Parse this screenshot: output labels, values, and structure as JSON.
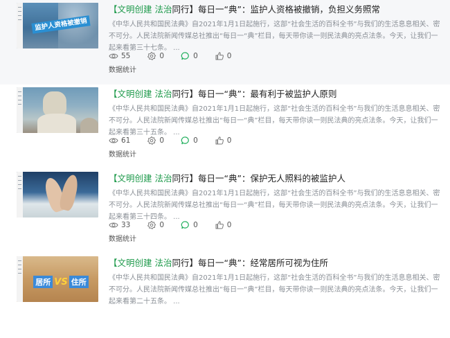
{
  "articles": [
    {
      "tag": "【文明创建 法治",
      "tag_suffix": "同行】",
      "title": "每日一“典”：监护人资格被撤销，负担义务照常",
      "summary": "《中华人民共和国民法典》自2021年1月1日起施行，这部“社会生活的百科全书”与我们的生活息息相关、密不可分。人民法院新闻传媒总社推出“每日一“典”栏目，每天带你读一则民法典的亮点法条。今天，让我们一起来看第三十七条。 ...",
      "thumb_caption": "监护人资格被撤销",
      "views": "55",
      "shares": "0",
      "comments": "0",
      "likes": "0",
      "data_link": "数据统计"
    },
    {
      "tag": "【文明创建 法治",
      "tag_suffix": "同行】",
      "title": "每日一“典”：最有利于被监护人原则",
      "summary": "《中华人民共和国民法典》自2021年1月1日起施行，这部“社会生活的百科全书”与我们的生活息息相关、密不可分。人民法院新闻传媒总社推出“每日一“典”栏目，每天带你读一则民法典的亮点法条。今天，让我们一起来看第三十五条。 ...",
      "thumb_caption": "",
      "views": "61",
      "shares": "0",
      "comments": "0",
      "likes": "0",
      "data_link": "数据统计"
    },
    {
      "tag": "【文明创建 法治",
      "tag_suffix": "同行】",
      "title": "每日一“典”：保护无人照料的被监护人",
      "summary": "《中华人民共和国民法典》自2021年1月1日起施行，这部“社会生活的百科全书”与我们的生活息息相关、密不可分。人民法院新闻传媒总社推出“每日一“典”栏目，每天带你读一则民法典的亮点法条。今天，让我们一起来看第三十四条。 ...",
      "thumb_caption": "",
      "views": "33",
      "shares": "0",
      "comments": "0",
      "likes": "0",
      "data_link": "数据统计"
    },
    {
      "tag": "【文明创建 法治",
      "tag_suffix": "同行】",
      "title": "每日一“典”：经常居所可视为住所",
      "summary": "《中华人民共和国民法典》自2021年1月1日起施行，这部“社会生活的百科全书”与我们的生活息息相关、密不可分。人民法院新闻传媒总社推出“每日一“典”栏目，每天带你读一则民法典的亮点法条。今天，让我们一起来看第二十五条。 ...",
      "thumb_caption_a": "居所",
      "thumb_caption_vs": "VS",
      "thumb_caption_b": "住所",
      "views": "",
      "shares": "",
      "comments": "",
      "likes": "",
      "data_link": ""
    }
  ],
  "colors": {
    "tag_green": "#1e9a4b",
    "comment_green": "#1fae5b",
    "muted_text": "#8a8f96",
    "highlight_row": "#f6f7f9"
  }
}
